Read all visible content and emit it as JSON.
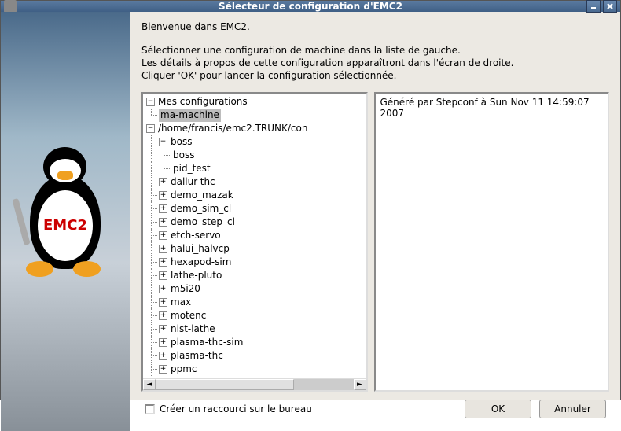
{
  "window": {
    "title": "Sélecteur de configuration d'EMC2"
  },
  "intro": {
    "welcome": "Bienvenue dans EMC2.",
    "line1": "Sélectionner une configuration de machine dans la liste de gauche.",
    "line2": "Les détails à propos de cette configuration apparaîtront dans l'écran de droite.",
    "line3": "Cliquer 'OK' pour lancer la configuration sélectionnée."
  },
  "tree": {
    "root1": "Mes configurations",
    "root1_child": "ma-machine",
    "root2": "/home/francis/emc2.TRUNK/con",
    "boss": "boss",
    "boss_child1": "boss",
    "boss_child2": "pid_test",
    "items": [
      "dallur-thc",
      "demo_mazak",
      "demo_sim_cl",
      "demo_step_cl",
      "etch-servo",
      "halui_halvcp",
      "hexapod-sim",
      "lathe-pluto",
      "m5i20",
      "max",
      "motenc",
      "nist-lathe",
      "plasma-thc-sim",
      "plasma-thc",
      "ppmc"
    ]
  },
  "details": {
    "text": "Généré par Stepconf à Sun Nov 11 14:59:07 2007"
  },
  "footer": {
    "shortcut_label": "Créer un raccourci sur le bureau",
    "ok": "OK",
    "cancel": "Annuler"
  },
  "mascot": {
    "belly_text": "EMC2"
  }
}
